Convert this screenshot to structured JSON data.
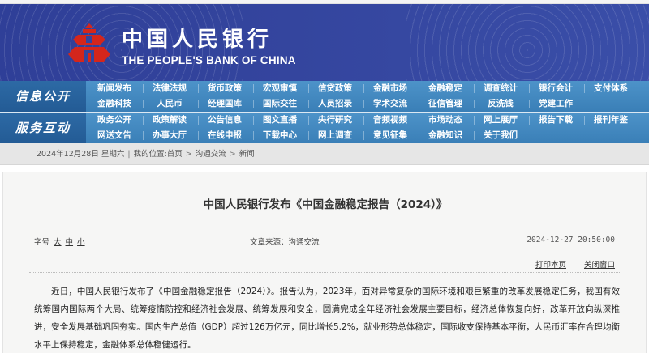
{
  "header": {
    "bank_name_cn": "中国人民银行",
    "bank_name_en": "THE PEOPLE'S BANK OF CHINA",
    "logo_icon": "pboc-emblem-icon",
    "colors": {
      "banner": "#34459e",
      "nav": "#4589c1",
      "logo": "#d4261c"
    }
  },
  "nav": {
    "info_label": "信息公开",
    "info_items": [
      "新闻发布",
      "法律法规",
      "货币政策",
      "宏观审慎",
      "信贷政策",
      "金融市场",
      "金融稳定",
      "调查统计",
      "银行会计",
      "支付体系",
      "金融科技",
      "人民币",
      "经理国库",
      "国际交往",
      "人员招录",
      "学术交流",
      "征信管理",
      "反洗钱",
      "党建工作"
    ],
    "service_label": "服务互动",
    "service_items": [
      "政务公开",
      "政策解读",
      "公告信息",
      "图文直播",
      "央行研究",
      "音频视频",
      "市场动态",
      "网上展厅",
      "报告下载",
      "报刊年鉴",
      "网送文告",
      "办事大厅",
      "在线申报",
      "下载中心",
      "网上调查",
      "意见征集",
      "金融知识",
      "关于我们"
    ]
  },
  "breadcrumb": {
    "date": "2024年12月28日 星期六",
    "location_label": "我的位置:",
    "items": [
      "首页",
      "沟通交流",
      "新闻"
    ]
  },
  "article": {
    "title": "中国人民银行发布《中国金融稳定报告（2024）》",
    "font_size_label": "字号",
    "font_sizes": [
      "大",
      "中",
      "小"
    ],
    "source": "文章来源：沟通交流",
    "datetime": "2024-12-27 20:50:00",
    "print_label": "打印本页",
    "close_label": "关闭窗口",
    "body": "近日，中国人民银行发布了《中国金融稳定报告（2024）》。报告认为，2023年，面对异常复杂的国际环境和艰巨繁重的改革发展稳定任务，我国有效统筹国内国际两个大局、统筹疫情防控和经济社会发展、统筹发展和安全，圆满完成全年经济社会发展主要目标，经济总体恢复向好，改革开放向纵深推进，安全发展基础巩固夯实。国内生产总值（GDP）超过126万亿元，同比增长5.2%，就业形势总体稳定，国际收支保持基本平衡，人民币汇率在合理均衡水平上保持稳定，金融体系总体稳健运行。"
  }
}
